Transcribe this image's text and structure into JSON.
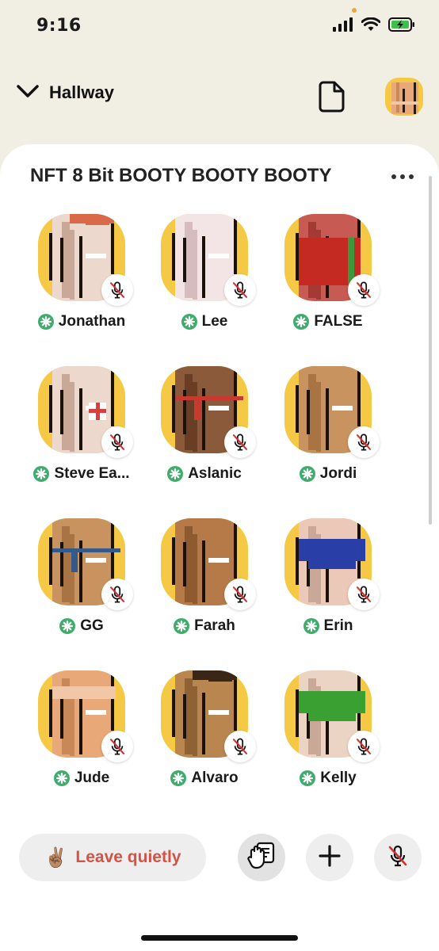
{
  "status_bar": {
    "time": "9:16"
  },
  "header": {
    "room_hallway_label": "Hallway"
  },
  "room": {
    "title": "NFT 8 Bit BOOTY BOOTY BOOTY",
    "speakers": [
      {
        "name": "Jonathan",
        "skin": "#ecd8cc",
        "shade": "#c9a898",
        "accent": "#d86a4a",
        "accent_style": "hair",
        "muted": true,
        "moderator": true
      },
      {
        "name": "Lee",
        "skin": "#f3e5e5",
        "shade": "#d6bcbc",
        "accent": "",
        "accent_style": "none",
        "muted": true,
        "moderator": true
      },
      {
        "name": "FALSE",
        "skin": "#c85a54",
        "shade": "#a43a34",
        "accent": "#c42a22",
        "accent_style": "shorts",
        "muted": true,
        "moderator": true
      },
      {
        "name": "Steve Ea...",
        "skin": "#ecd8cc",
        "shade": "#c9a898",
        "accent": "#d84040",
        "accent_style": "patch",
        "muted": true,
        "moderator": true
      },
      {
        "name": "Aslanic",
        "skin": "#8b5a3a",
        "shade": "#6a3e24",
        "accent": "#c83a2e",
        "accent_style": "thong",
        "muted": true,
        "moderator": true
      },
      {
        "name": "Jordi",
        "skin": "#c8935e",
        "shade": "#a87444",
        "accent": "",
        "accent_style": "none",
        "muted": true,
        "moderator": true
      },
      {
        "name": "GG",
        "skin": "#c8935e",
        "shade": "#a87444",
        "accent": "#355a8a",
        "accent_style": "thong",
        "muted": true,
        "moderator": true
      },
      {
        "name": "Farah",
        "skin": "#b57a48",
        "shade": "#8e5a30",
        "accent": "",
        "accent_style": "none",
        "muted": true,
        "moderator": true
      },
      {
        "name": "Erin",
        "skin": "#ecc8b8",
        "shade": "#c9a898",
        "accent": "#2a3ea8",
        "accent_style": "briefs",
        "muted": true,
        "moderator": true
      },
      {
        "name": "Jude",
        "skin": "#e8a878",
        "shade": "#c88858",
        "accent": "#f0c8a8",
        "accent_style": "band",
        "muted": true,
        "moderator": true
      },
      {
        "name": "Alvaro",
        "skin": "#b8864e",
        "shade": "#8e6234",
        "accent": "#3a2616",
        "accent_style": "hair",
        "muted": true,
        "moderator": true
      },
      {
        "name": "Kelly",
        "skin": "#ecd4c4",
        "shade": "#c9a898",
        "accent": "#3aa032",
        "accent_style": "briefs",
        "muted": true,
        "moderator": true
      }
    ]
  },
  "bottom_bar": {
    "leave_emoji": "✌🏽",
    "leave_label": "Leave quietly"
  },
  "colors": {
    "page_bg": "#f1efe4",
    "panel_bg": "#ffffff",
    "moderator_green": "#3eac6a",
    "leave_red": "#d35445",
    "mute_red": "#d32f2f",
    "avatar_yellow": "#f5c945"
  }
}
